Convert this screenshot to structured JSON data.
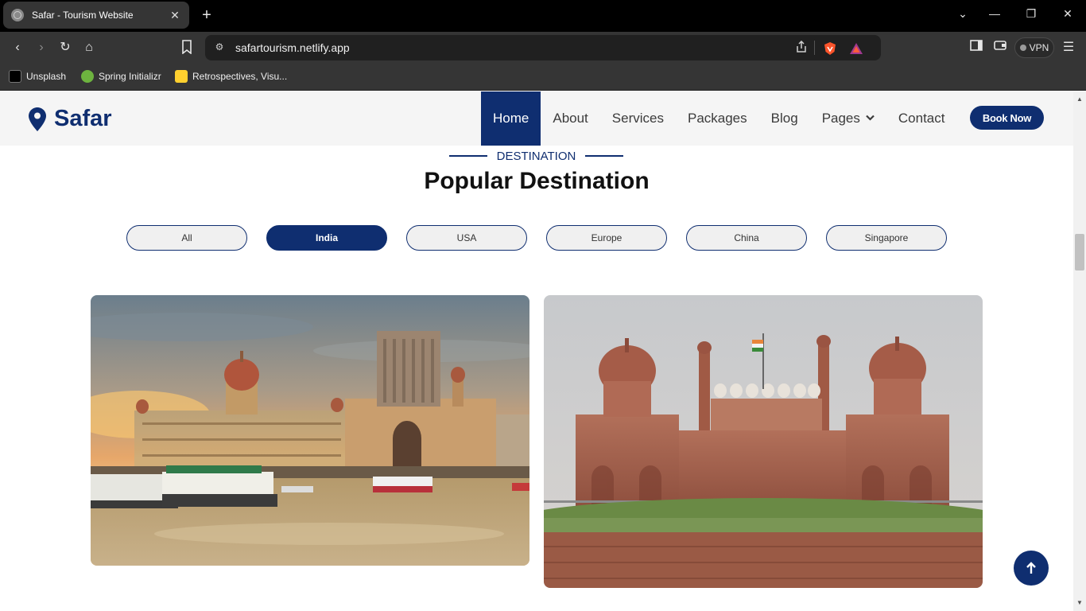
{
  "browser": {
    "tab_title": "Safar - Tourism Website",
    "url": "safartourism.netlify.app",
    "vpn_label": "VPN",
    "bookmarks": [
      {
        "label": "Unsplash"
      },
      {
        "label": "Spring Initializr"
      },
      {
        "label": "Retrospectives, Visu..."
      }
    ]
  },
  "header": {
    "brand": "Safar",
    "nav": [
      {
        "label": "Home",
        "active": true
      },
      {
        "label": "About"
      },
      {
        "label": "Services"
      },
      {
        "label": "Packages"
      },
      {
        "label": "Blog"
      },
      {
        "label": "Pages",
        "has_dropdown": true
      },
      {
        "label": "Contact"
      }
    ],
    "cta": "Book Now"
  },
  "section": {
    "kicker": "DESTINATION",
    "title": "Popular Destination"
  },
  "filters": [
    {
      "label": "All"
    },
    {
      "label": "India",
      "active": true
    },
    {
      "label": "USA"
    },
    {
      "label": "Europe"
    },
    {
      "label": "China"
    },
    {
      "label": "Singapore"
    }
  ],
  "cards": [
    {
      "image": "gateway-of-india-and-taj-hotel-photo"
    },
    {
      "image": "red-fort-delhi-photo"
    }
  ],
  "icons": {
    "back_to_top": "arrow-up-icon"
  },
  "colors": {
    "brand": "#0f2e70",
    "header_bg": "#f5f5f5"
  }
}
